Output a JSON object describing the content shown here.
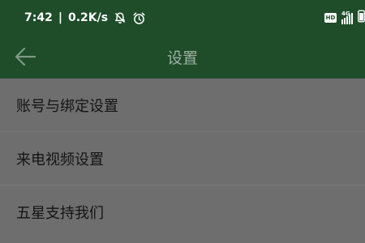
{
  "status_bar": {
    "time": "7:42",
    "separator": "|",
    "net_speed": "0.2K/s",
    "hd_badge": "HD",
    "network_type": "4G",
    "icons": [
      "bell-off-icon",
      "alarm-icon",
      "hd-icon",
      "signal-icon",
      "battery-icon"
    ]
  },
  "toolbar": {
    "title": "设置",
    "back_icon": "arrow-left-icon"
  },
  "settings": {
    "items": [
      {
        "label": "账号与绑定设置"
      },
      {
        "label": "来电视频设置"
      },
      {
        "label": "五星支持我们"
      }
    ]
  },
  "colors": {
    "header_bg": "#1f4d2a",
    "content_bg": "#6e6e6e",
    "text": "#141414",
    "title_text": "#9fb0a3"
  }
}
